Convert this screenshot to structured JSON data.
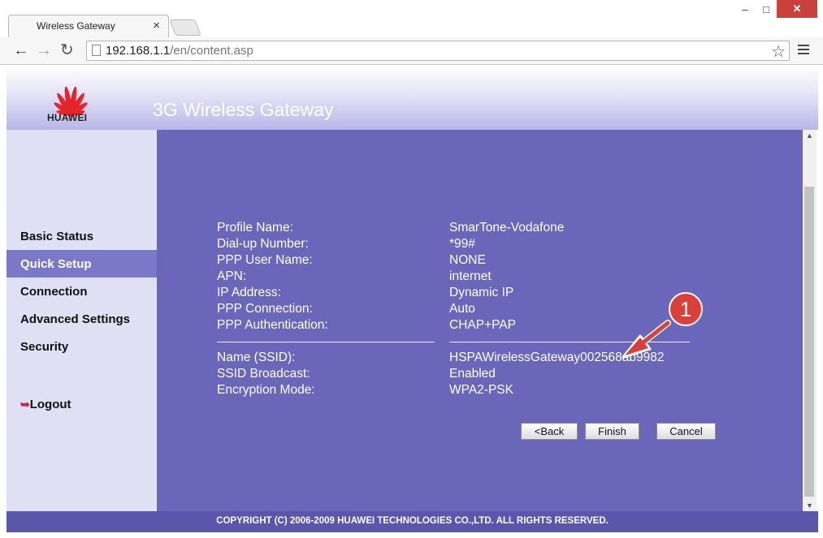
{
  "browser": {
    "tab_title": "Wireless Gateway",
    "tab_close": "×",
    "url_host": "192.168.1.1",
    "url_path": "/en/content.asp",
    "window_buttons": {
      "minimize": "–",
      "maximize": "□",
      "close": "✕"
    }
  },
  "header": {
    "brand": "HUAWEI",
    "title": "3G Wireless Gateway"
  },
  "sidebar": {
    "items": [
      {
        "label": "Basic Status"
      },
      {
        "label": "Quick Setup"
      },
      {
        "label": "Connection"
      },
      {
        "label": "Advanced Settings"
      },
      {
        "label": "Security"
      }
    ],
    "logout_label": "Logout",
    "active_item": "Quick Setup"
  },
  "summary": {
    "profile": [
      {
        "label": "Profile Name:",
        "value": "SmarTone-Vodafone"
      },
      {
        "label": "Dial-up Number:",
        "value": "*99#"
      },
      {
        "label": "PPP User Name:",
        "value": "NONE"
      },
      {
        "label": "APN:",
        "value": "internet"
      },
      {
        "label": "IP Address:",
        "value": "Dynamic IP"
      },
      {
        "label": "PPP Connection:",
        "value": "Auto"
      },
      {
        "label": "PPP Authentication:",
        "value": "CHAP+PAP"
      }
    ],
    "wireless": [
      {
        "label": "Name (SSID):",
        "value": "HSPAWirelessGateway002568ab9982"
      },
      {
        "label": "SSID Broadcast:",
        "value": "Enabled"
      },
      {
        "label": "Encryption Mode:",
        "value": "WPA2-PSK"
      }
    ]
  },
  "buttons": {
    "back": "<Back",
    "finish": "Finish",
    "cancel": "Cancel"
  },
  "annotation": {
    "step_number": "1",
    "color": "#d9403a"
  },
  "footer": {
    "copyright": "COPYRIGHT (C) 2006-2009 HUAWEI TECHNOLOGIES CO.,LTD. ALL RIGHTS RESERVED."
  },
  "colors": {
    "content_bg": "#6a66ba",
    "sidebar_bg": "#e0e0f5",
    "active_nav": "#7b78c8",
    "footer_bg": "#5956ac"
  }
}
